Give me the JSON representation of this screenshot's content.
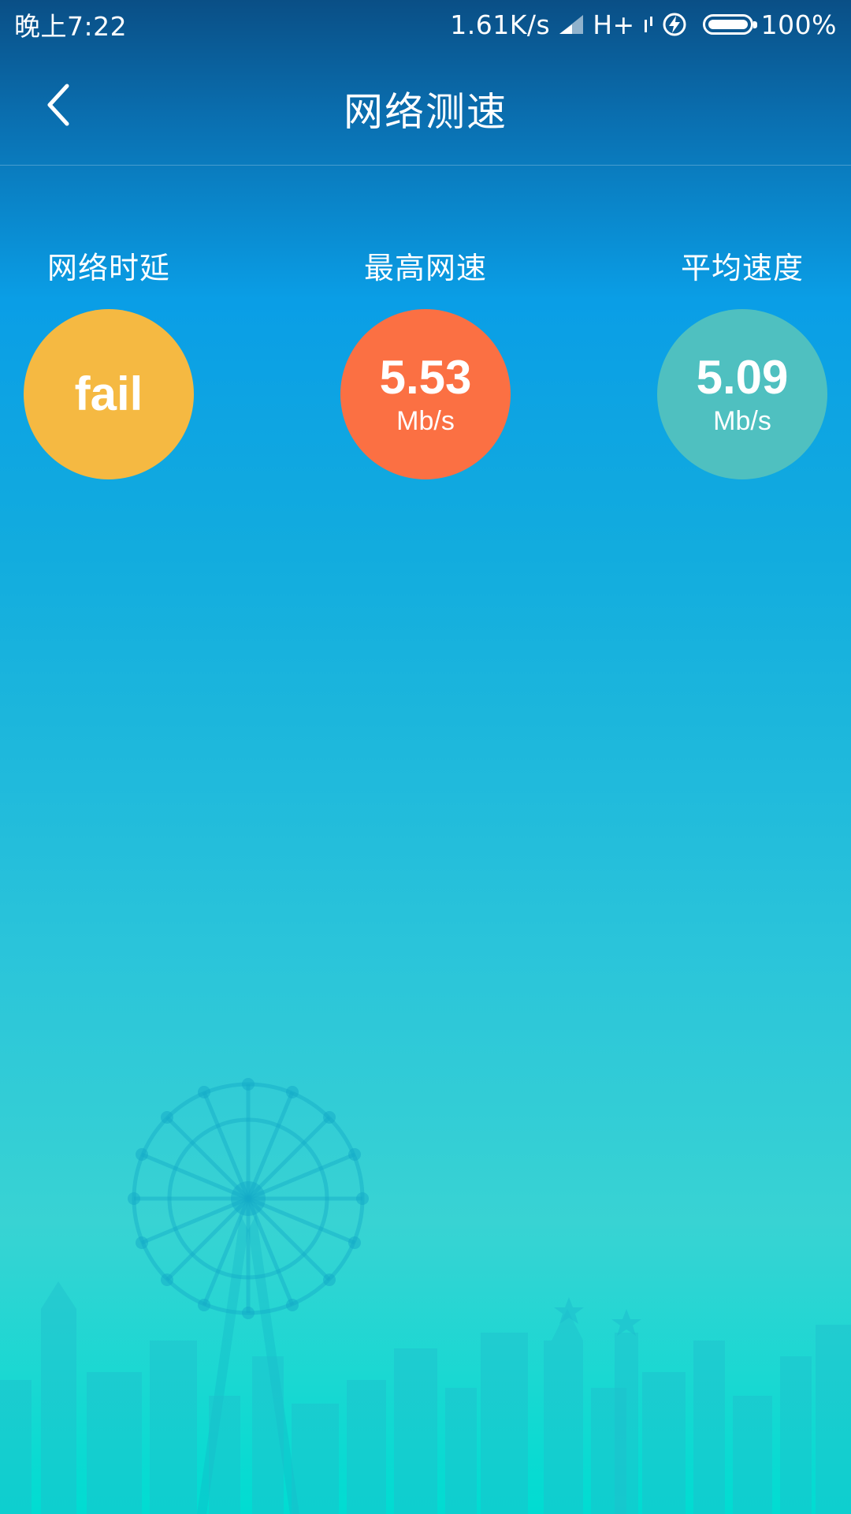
{
  "status_bar": {
    "time": "晚上7:22",
    "net_speed": "1.61K/s",
    "network_type": "H+",
    "battery": "100%"
  },
  "header": {
    "title": "网络测速",
    "back_icon": "chevron-left-icon"
  },
  "metrics": [
    {
      "label": "网络时延",
      "value": "fail",
      "unit": "",
      "color": "#f5b942"
    },
    {
      "label": "最高网速",
      "value": "5.53",
      "unit": "Mb/s",
      "color": "#fb7043"
    },
    {
      "label": "平均速度",
      "value": "5.09",
      "unit": "Mb/s",
      "color": "#4fc0c0"
    }
  ],
  "colors": {
    "top": "#0a4f86",
    "middle": "#0a9ee6",
    "bottom": "#00dcd2"
  }
}
